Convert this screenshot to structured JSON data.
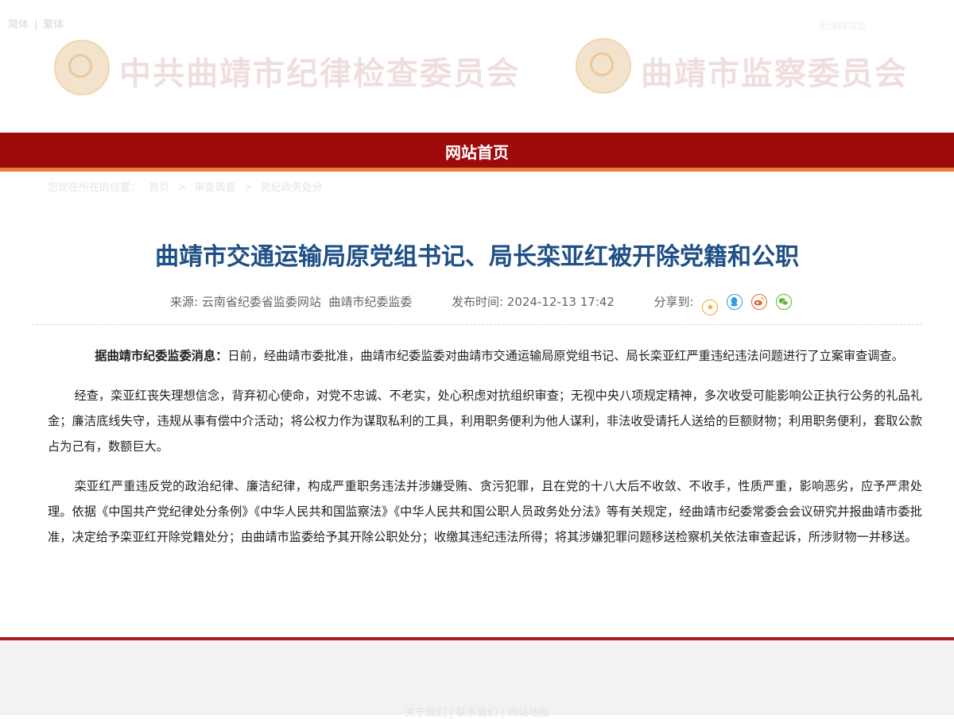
{
  "topbar": {
    "simplified": "简体",
    "traditional": "繁体",
    "separator": "|"
  },
  "topright": {
    "text": "无障碍浏览"
  },
  "banner": {
    "left_title": "中共曲靖市纪律检查委员会",
    "right_title": "曲靖市监察委员会"
  },
  "nav": {
    "home": "网站首页"
  },
  "breadcrumb": {
    "prefix": "您现在所在的位置：",
    "items": [
      "首页",
      "审查调查",
      "党纪政务处分"
    ],
    "separator": ">"
  },
  "article": {
    "title": "曲靖市交通运输局原党组书记、局长栾亚红被开除党籍和公职",
    "source_label": "来源:",
    "source_value": "云南省纪委省监委网站  曲靖市纪委监委",
    "time_label": "发布时间:",
    "time_value": "2024-12-13 17:42",
    "share_label": "分享到:",
    "share_icons": [
      "star-icon",
      "qq-icon",
      "weibo-icon",
      "wechat-icon"
    ],
    "lead_bold": "据曲靖市纪委监委消息：",
    "paragraphs": [
      "日前，经曲靖市委批准，曲靖市纪委监委对曲靖市交通运输局原党组书记、局长栾亚红严重违纪违法问题进行了立案审查调查。",
      "经查，栾亚红丧失理想信念，背弃初心使命，对党不忠诚、不老实，处心积虑对抗组织审查；无视中央八项规定精神，多次收受可能影响公正执行公务的礼品礼金；廉洁底线失守，违规从事有偿中介活动；将公权力作为谋取私利的工具，利用职务便利为他人谋利，非法收受请托人送给的巨额财物；利用职务便利，套取公款占为己有，数额巨大。",
      "栾亚红严重违反党的政治纪律、廉洁纪律，构成严重职务违法并涉嫌受贿、贪污犯罪，且在党的十八大后不收敛、不收手，性质严重，影响恶劣，应予严肃处理。依据《中国共产党纪律处分条例》《中华人民共和国监察法》《中华人民共和国公职人员政务处分法》等有关规定，经曲靖市纪委常委会会议研究并报曲靖市委批准，决定给予栾亚红开除党籍处分；由曲靖市监委给予其开除公职处分；收缴其违纪违法所得；将其涉嫌犯罪问题移送检察机关依法审查起诉，所涉财物一并移送。"
    ]
  },
  "footer": {
    "text": "关于我们 | 联系我们 | 网站地图"
  },
  "colors": {
    "nav_bg": "#9d0a0b",
    "nav_accent": "#ee7a3e",
    "title": "#1e4f86",
    "bottom_line": "#a71c1c"
  }
}
